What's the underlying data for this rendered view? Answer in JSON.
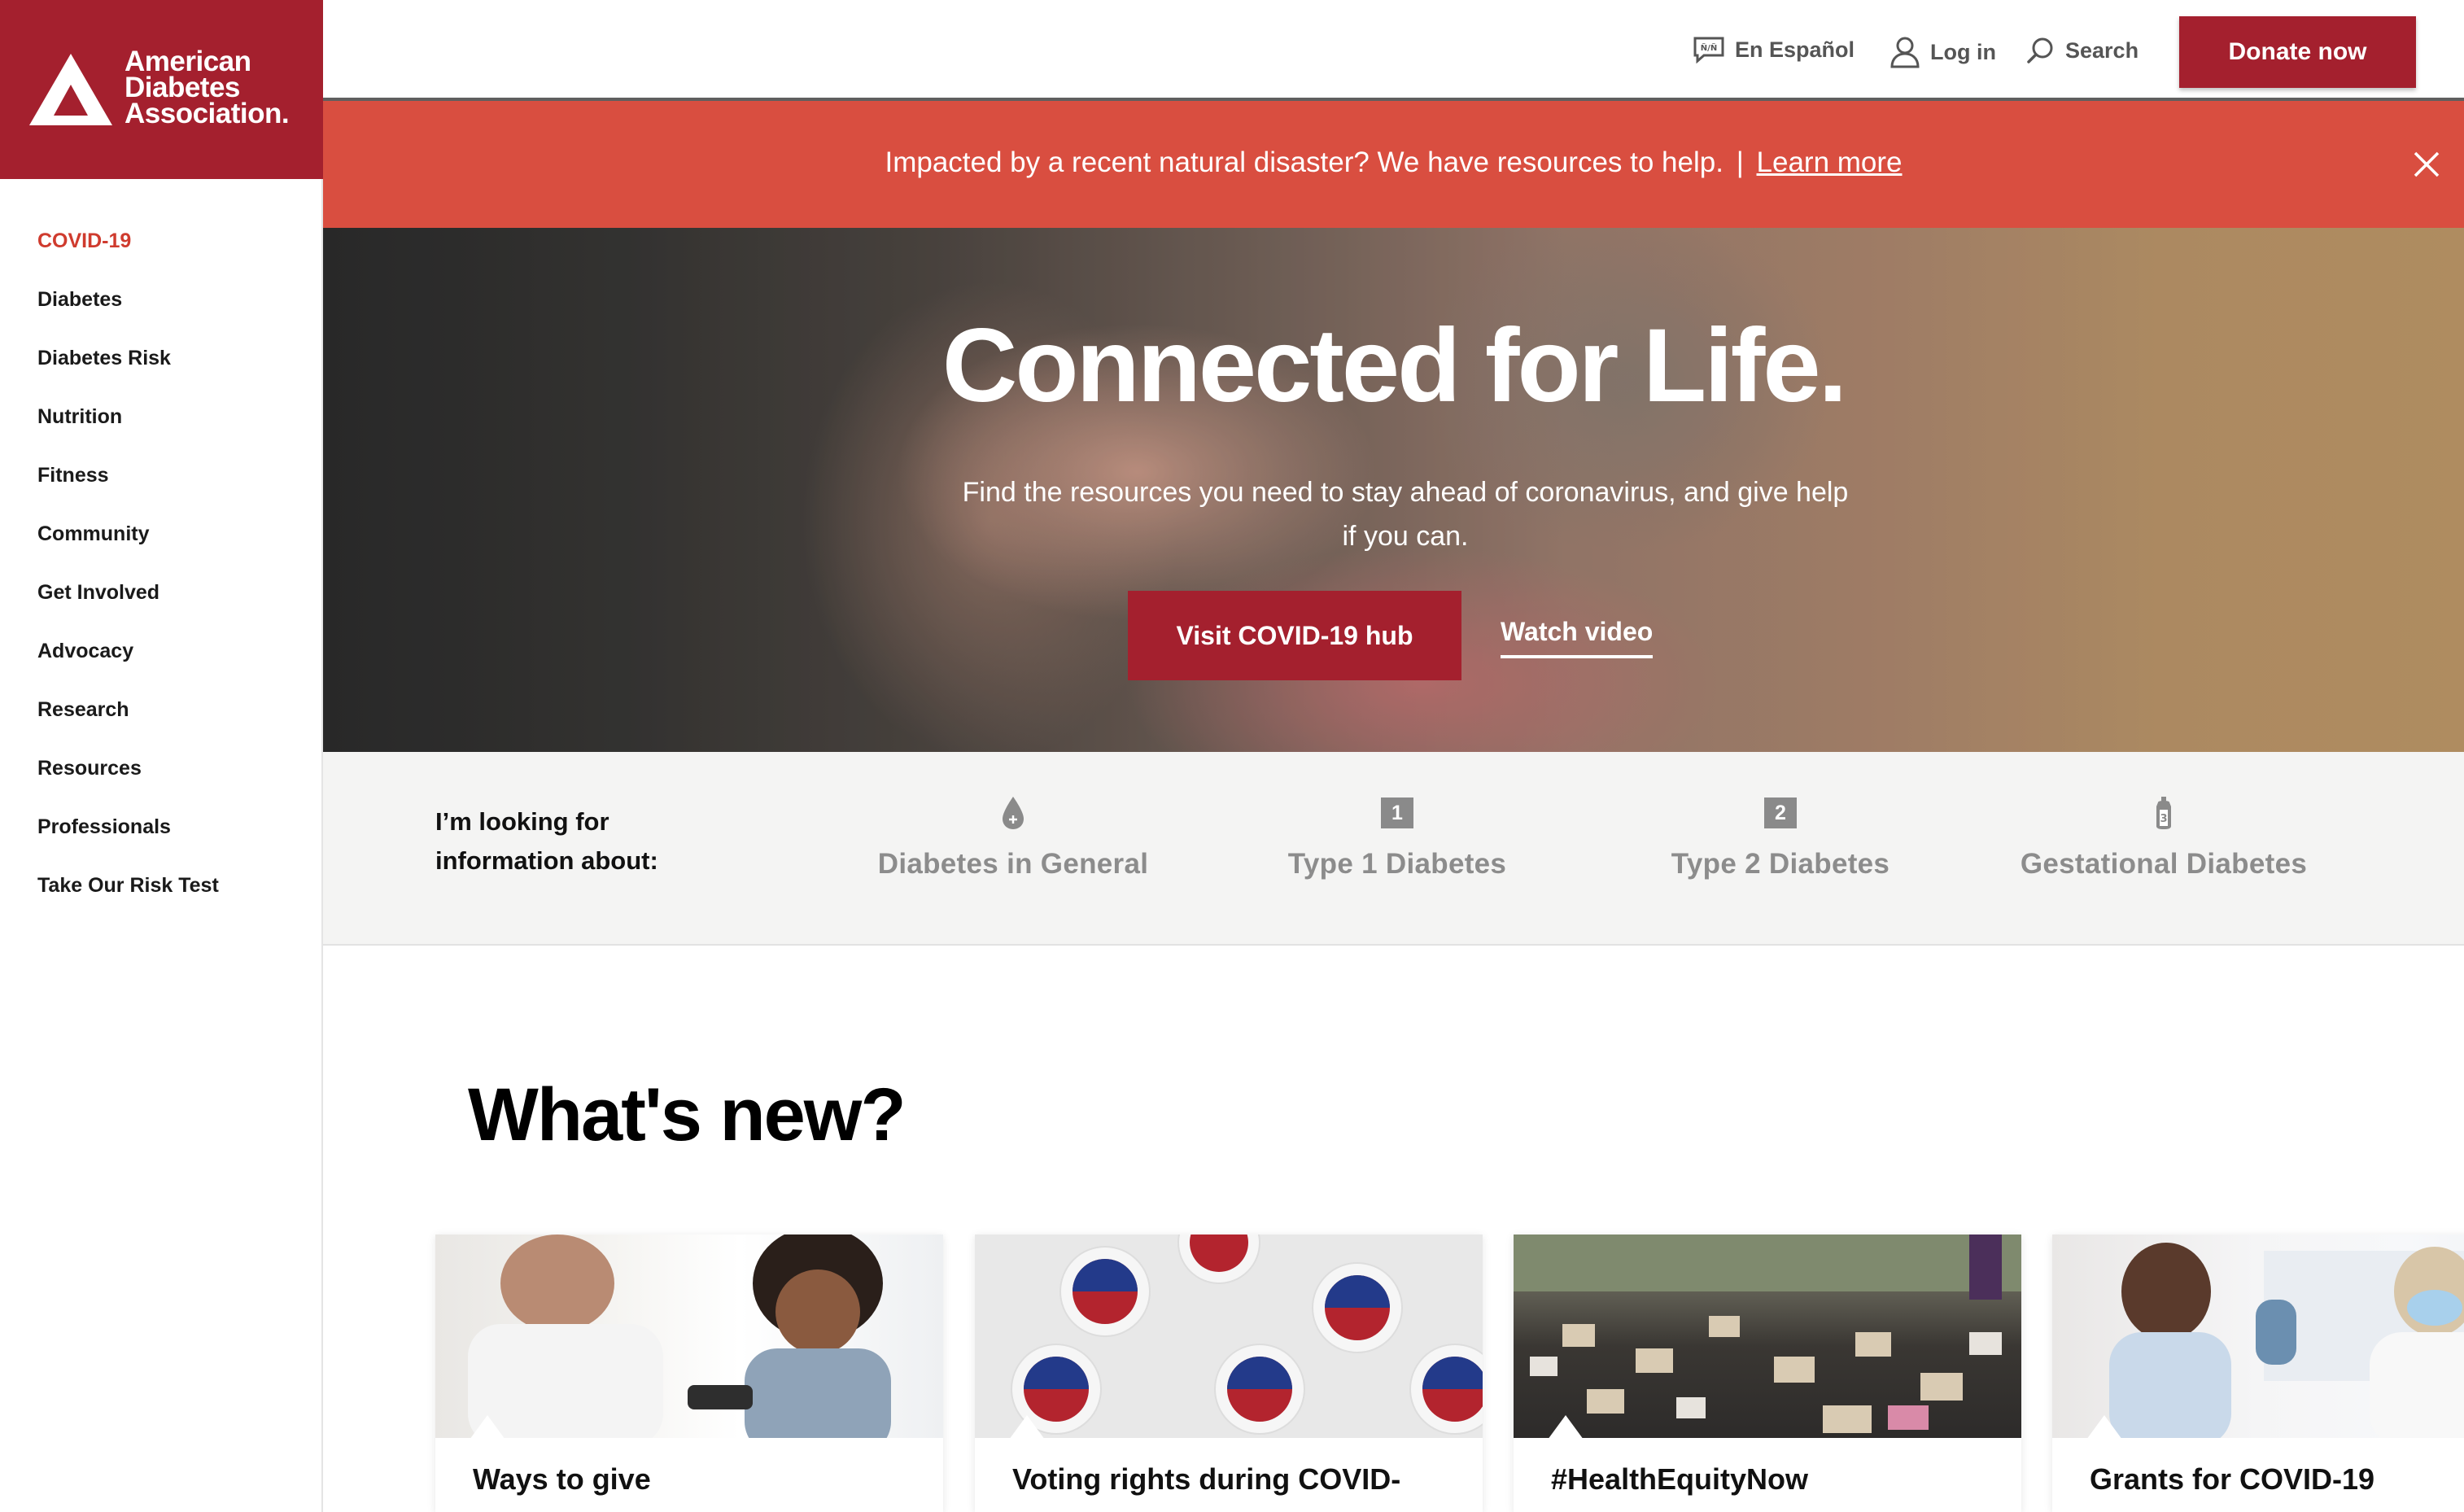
{
  "brand": {
    "logo_lines": [
      "American",
      "Diabetes",
      "Association."
    ],
    "primary_color": "#a4202e",
    "alert_color": "#d94e40"
  },
  "sidebar": {
    "items": [
      {
        "label": "COVID-19",
        "active": true
      },
      {
        "label": "Diabetes"
      },
      {
        "label": "Diabetes Risk"
      },
      {
        "label": "Nutrition"
      },
      {
        "label": "Fitness"
      },
      {
        "label": "Community"
      },
      {
        "label": "Get Involved"
      },
      {
        "label": "Advocacy"
      },
      {
        "label": "Research"
      },
      {
        "label": "Resources"
      },
      {
        "label": "Professionals"
      },
      {
        "label": "Take Our Risk Test"
      }
    ]
  },
  "topbar": {
    "espanol": "En Español",
    "espanol_icon": "speech-bubble-icon",
    "login": "Log in",
    "login_icon": "user-icon",
    "search": "Search",
    "search_icon": "search-icon",
    "donate": "Donate now"
  },
  "alert": {
    "message": "Impacted by a recent natural disaster? We have resources to help.",
    "separator": "|",
    "link": "Learn more",
    "close_icon": "close-icon"
  },
  "hero": {
    "title": "Connected for Life.",
    "subtitle": "Find the resources you need to stay ahead of coronavirus, and give help if you can.",
    "primary_button": "Visit COVID-19 hub",
    "secondary_link": "Watch video"
  },
  "lookfor": {
    "label": "I’m looking for information about:",
    "topics": [
      {
        "label": "Diabetes in General",
        "icon": "blood-drop-icon"
      },
      {
        "label": "Type 1 Diabetes",
        "icon": "number-1-icon",
        "badge": "1"
      },
      {
        "label": "Type 2 Diabetes",
        "icon": "number-2-icon",
        "badge": "2"
      },
      {
        "label": "Gestational Diabetes",
        "icon": "baby-bottle-icon"
      }
    ]
  },
  "whatsnew": {
    "heading": "What's new?",
    "cards": [
      {
        "title": "Ways to give"
      },
      {
        "title": "Voting rights during COVID-"
      },
      {
        "title": "#HealthEquityNow"
      },
      {
        "title": "Grants for COVID-19"
      }
    ]
  }
}
